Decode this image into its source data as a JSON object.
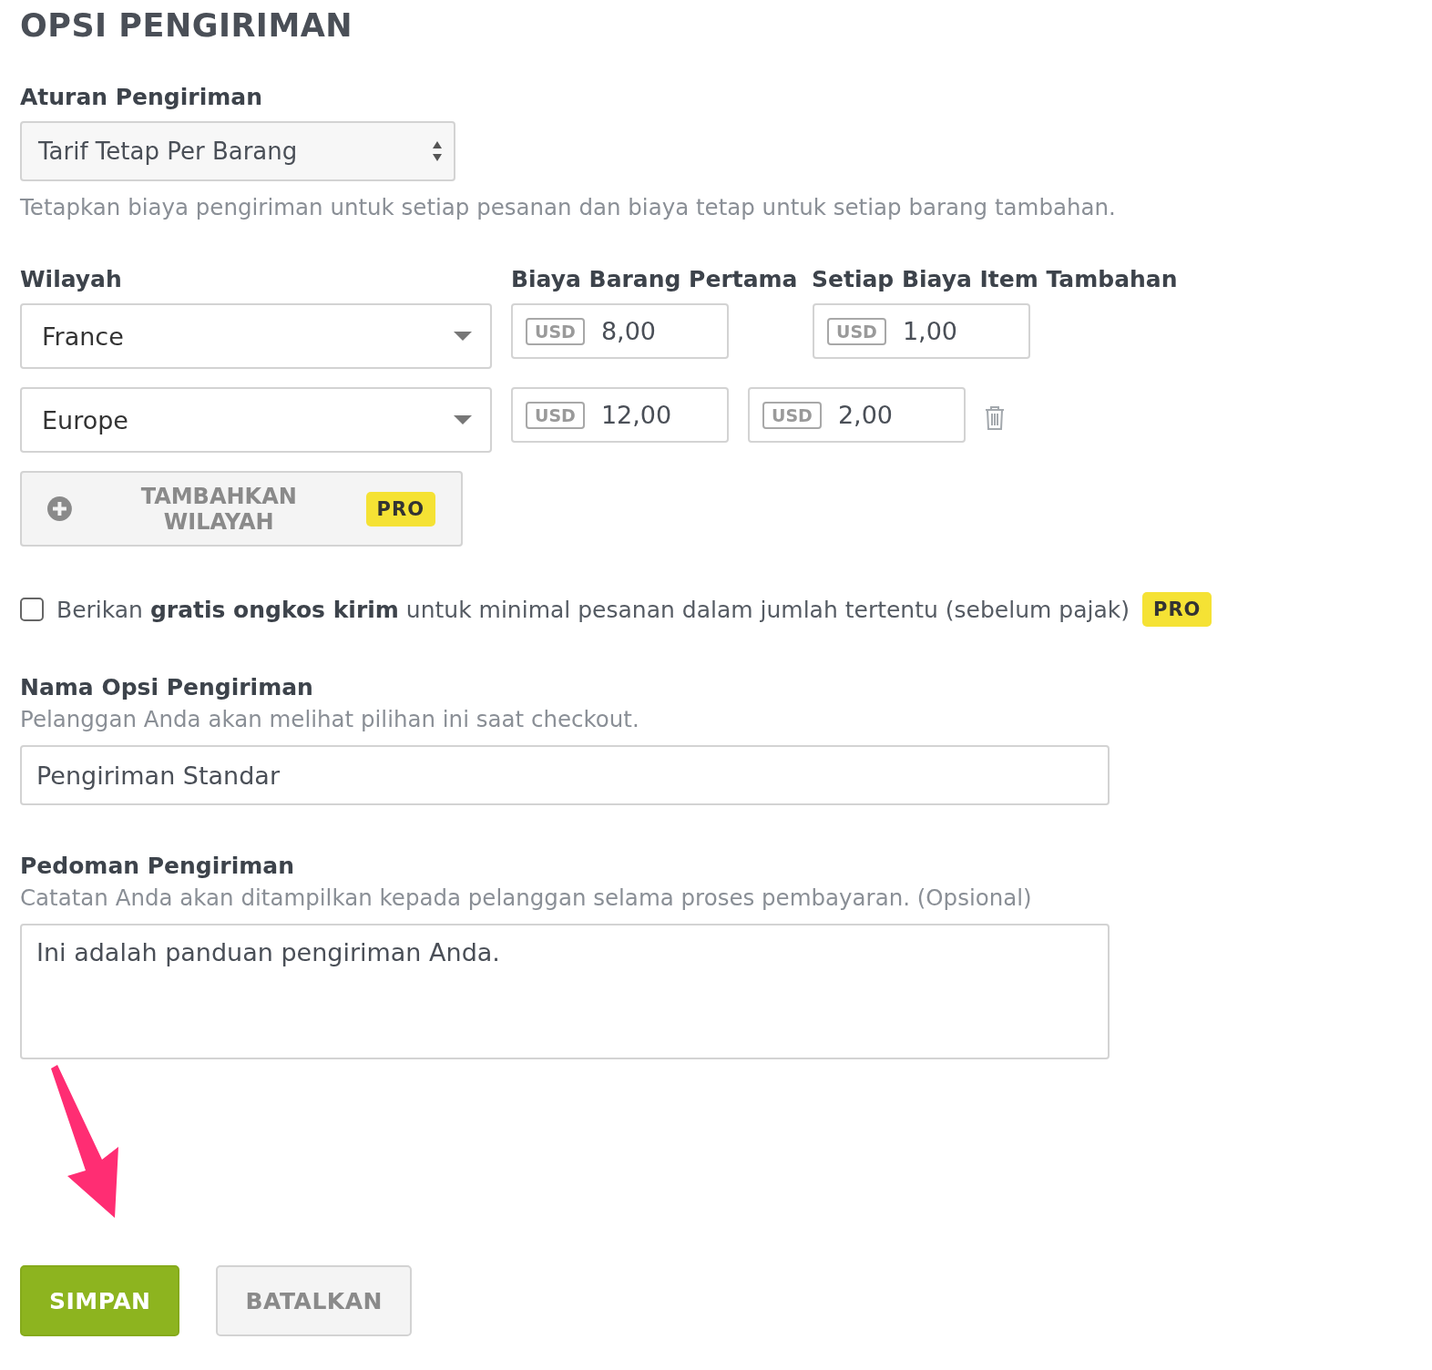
{
  "title": "OPSI PENGIRIMAN",
  "shipping_rule": {
    "label": "Aturan Pengiriman",
    "value": "Tarif Tetap Per Barang",
    "help": "Tetapkan biaya pengiriman untuk setiap pesanan dan biaya tetap untuk setiap barang tambahan."
  },
  "regions": {
    "columns": [
      "Wilayah",
      "Biaya Barang Pertama",
      "Setiap Biaya Item Tambahan"
    ],
    "rows": [
      {
        "region": "France",
        "first_currency": "USD",
        "first_cost": "8,00",
        "additional_currency": "USD",
        "additional_cost": "1,00",
        "deletable": false
      },
      {
        "region": "Europe",
        "first_currency": "USD",
        "first_cost": "12,00",
        "additional_currency": "USD",
        "additional_cost": "2,00",
        "deletable": true
      }
    ]
  },
  "add_region": {
    "label": "TAMBAHKAN WILAYAH",
    "badge": "PRO"
  },
  "free_shipping": {
    "checked": false,
    "text": "Berikan **gratis ongkos kirim** untuk minimal pesanan dalam jumlah tertentu (sebelum pajak)",
    "badge": "PRO"
  },
  "option_name": {
    "label": "Nama Opsi Pengiriman",
    "help": "Pelanggan Anda akan melihat pilihan ini saat checkout.",
    "value": "Pengiriman Standar"
  },
  "guidelines": {
    "label": "Pedoman Pengiriman",
    "help": "Catatan Anda akan ditampilkan kepada pelanggan selama proses pembayaran. (Opsional)",
    "value": "Ini adalah panduan pengiriman Anda."
  },
  "buttons": [
    {
      "label": "SIMPAN",
      "kind": "primary"
    },
    {
      "label": "BATALKAN",
      "kind": "secondary"
    }
  ]
}
